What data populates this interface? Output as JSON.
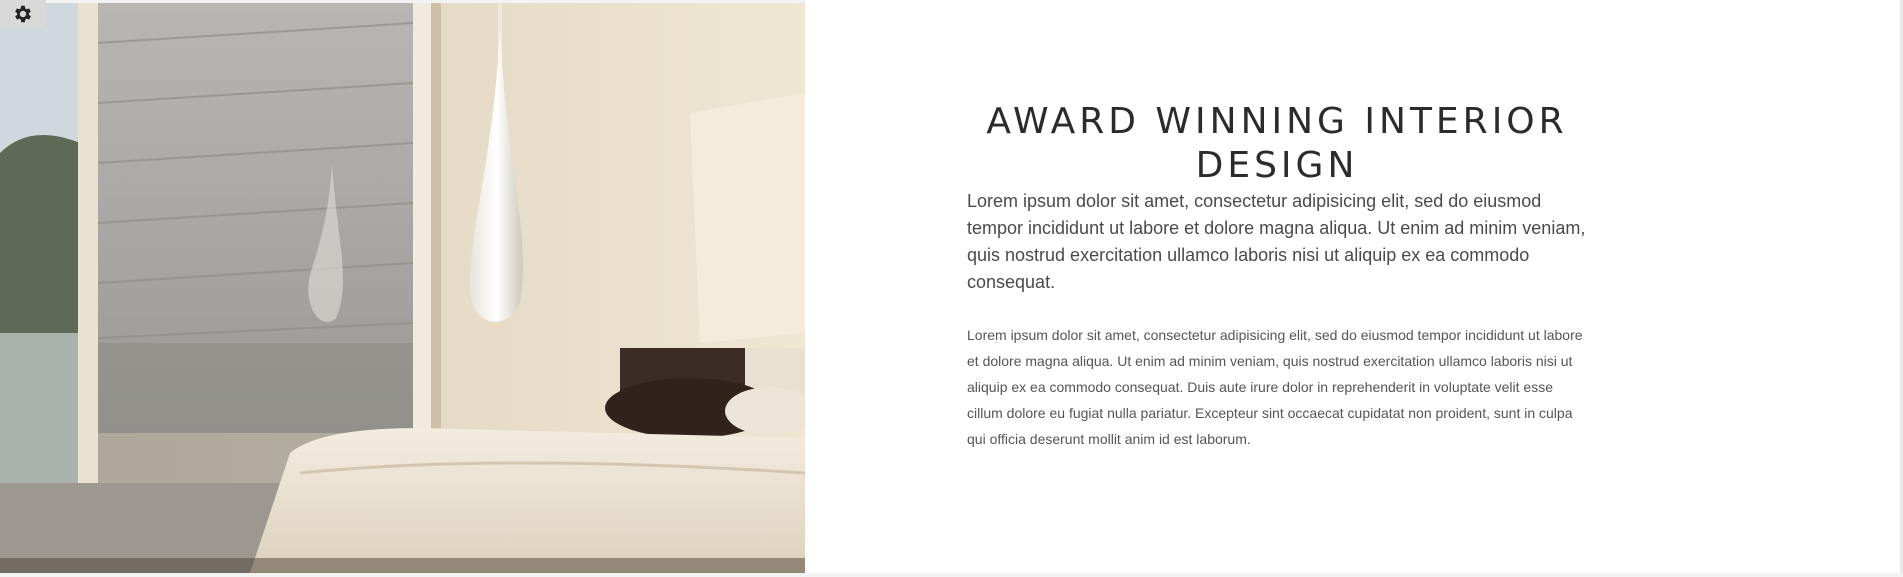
{
  "hero": {
    "image_alt": "Modern bedroom with glass wall, hanging teardrop pendant lamp and white bed"
  },
  "content": {
    "headline": "AWARD WINNING INTERIOR DESIGN",
    "lead": "Lorem ipsum dolor sit amet, consectetur adipisicing elit, sed do eiusmod tempor incididunt ut labore et dolore magna aliqua. Ut enim ad minim veniam, quis nostrud exercitation ullamco laboris nisi ut aliquip ex ea commodo consequat.",
    "body": "Lorem ipsum dolor sit amet, consectetur adipisicing elit, sed do eiusmod tempor incididunt ut labore et dolore magna aliqua. Ut enim ad minim veniam, quis nostrud exercitation ullamco laboris nisi ut aliquip ex ea commodo consequat. Duis aute irure dolor in reprehenderit in voluptate velit esse cillum dolore eu fugiat nulla pariatur. Excepteur sint occaecat cupidatat non proident, sunt in culpa qui officia deserunt mollit anim id est laborum."
  },
  "settings": {
    "icon": "gear-icon"
  },
  "colors": {
    "headline": "#2b2b2b",
    "text": "#4a4a4a",
    "settings_bg": "#d9d9d9"
  }
}
